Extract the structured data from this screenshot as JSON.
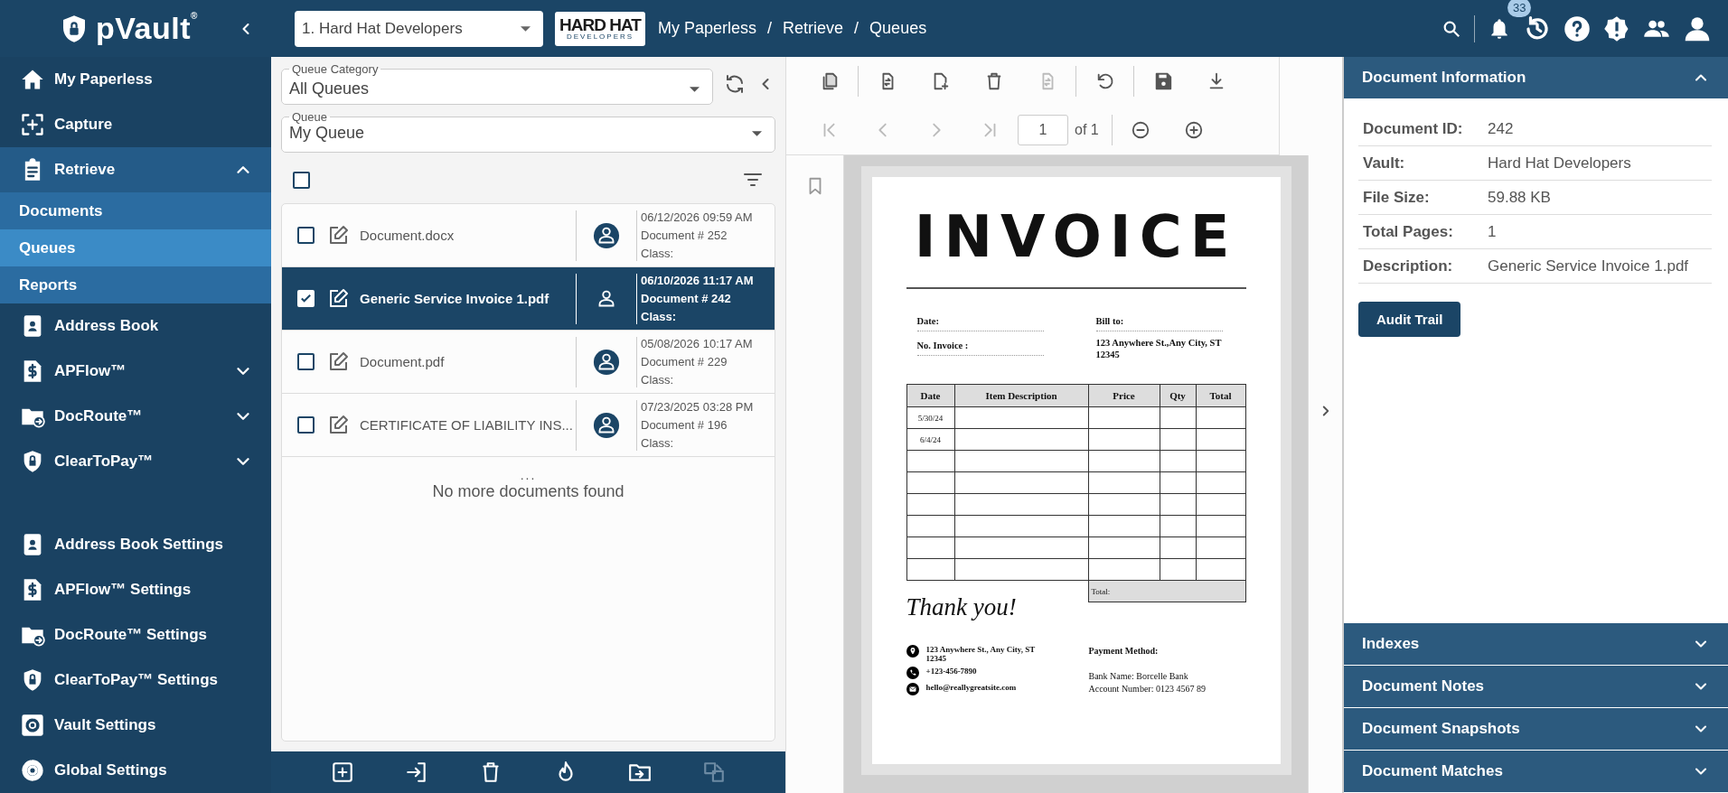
{
  "header": {
    "brand": "pVault$^{®}$",
    "vault_select": "1. Hard Hat Developers",
    "logo_text": "HARD HAT",
    "logo_subtext": "DEVELOPERS",
    "breadcrumbs": [
      "My Paperless",
      "/",
      "Retrieve",
      "/",
      "Queues"
    ],
    "notification_count": "33"
  },
  "sidebar": {
    "items": [
      {
        "label": "My Paperless",
        "kind": "link",
        "selected": false
      },
      {
        "label": "Capture",
        "kind": "link",
        "selected": false
      },
      {
        "label": "Retrieve",
        "kind": "group",
        "selected": false,
        "expanded": true,
        "children": [
          {
            "label": "Documents",
            "selected": false
          },
          {
            "label": "Queues",
            "selected": true
          },
          {
            "label": "Reports",
            "selected": false
          }
        ]
      },
      {
        "label": "Address Book",
        "kind": "link",
        "selected": false
      },
      {
        "label": "APFlow™",
        "kind": "group",
        "selected": false,
        "expanded": false
      },
      {
        "label": "DocRoute™",
        "kind": "group",
        "selected": false,
        "expanded": false
      },
      {
        "label": "ClearToPay™",
        "kind": "group",
        "selected": false,
        "expanded": false
      }
    ],
    "settings_items": [
      {
        "label": "Address Book Settings",
        "selected": false
      },
      {
        "label": "APFlow™ Settings",
        "selected": false
      },
      {
        "label": "DocRoute™ Settings",
        "selected": false
      },
      {
        "label": "ClearToPay™ Settings",
        "selected": false
      },
      {
        "label": "Vault Settings",
        "selected": false
      },
      {
        "label": "Global Settings",
        "selected": false
      }
    ]
  },
  "queue_panel": {
    "category_field": {
      "label": "Queue Category",
      "value": "All Queues"
    },
    "queue_field": {
      "label": "Queue",
      "value": "My Queue"
    },
    "select_all_checked": false,
    "documents": [
      {
        "name": "Document.docx",
        "date": "06/12/2026 09:59 AM",
        "number": "Document # 252",
        "class": "Class:",
        "checked": false,
        "selected": false
      },
      {
        "name": "Generic Service Invoice 1.pdf",
        "date": "06/10/2026 11:17 AM",
        "number": "Document # 242",
        "class": "Class:",
        "checked": true,
        "selected": true
      },
      {
        "name": "Document.pdf",
        "date": "05/08/2026 10:17 AM",
        "number": "Document # 229",
        "class": "Class:",
        "checked": false,
        "selected": false
      },
      {
        "name": "CERTIFICATE OF LIABILITY INS...",
        "date": "07/23/2025 03:28 PM",
        "number": "Document # 196",
        "class": "Class:",
        "checked": false,
        "selected": false
      }
    ],
    "list_end_dots": "...",
    "list_end_text": "No more documents found",
    "toolbar": [
      {
        "kind": "add",
        "disabled": false
      },
      {
        "kind": "move_in",
        "disabled": false
      },
      {
        "kind": "delete",
        "disabled": false
      },
      {
        "kind": "burn",
        "disabled": false
      },
      {
        "kind": "folder_move",
        "disabled": false
      },
      {
        "kind": "split",
        "disabled": true
      }
    ]
  },
  "viewer": {
    "toolbar": [
      {
        "kind": "copy",
        "disabled": false
      },
      {
        "kind": "divider"
      },
      {
        "kind": "swap",
        "disabled": false
      },
      {
        "kind": "add_page",
        "disabled": false
      },
      {
        "kind": "delete",
        "disabled": false
      },
      {
        "kind": "replace",
        "disabled": true
      },
      {
        "kind": "divider"
      },
      {
        "kind": "undo",
        "disabled": false
      },
      {
        "kind": "divider"
      },
      {
        "kind": "save",
        "disabled": false
      },
      {
        "kind": "download",
        "disabled": false
      }
    ],
    "navigation": [
      {
        "kind": "first",
        "disabled": true
      },
      {
        "kind": "prev",
        "disabled": true
      },
      {
        "kind": "next",
        "disabled": true
      },
      {
        "kind": "last",
        "disabled": true
      }
    ],
    "page_field": "1",
    "page_total": "of 1",
    "zoom": [
      {
        "kind": "zoom_out",
        "disabled": false
      },
      {
        "kind": "zoom_in",
        "disabled": false
      }
    ],
    "invoice": {
      "title": "INVOICE",
      "date_label": "Date:",
      "number_label": "No. Invoice :",
      "bill_to_label": "Bill to:",
      "bill_to_address": "123 Anywhere St.,Any City, ST 12345",
      "columns": [
        "Date",
        "Item Description",
        "Price",
        "Qty",
        "Total"
      ],
      "rows": [
        {
          "date": "5/30/24"
        },
        {
          "date": "6/4/24"
        },
        {},
        {},
        {},
        {},
        {},
        {}
      ],
      "total_label": "Total:",
      "thanks": "Thank you!",
      "address": "123 Anywhere St., Any City, ST 12345",
      "phone": "+123-456-7890",
      "email": "hello@reallygreatsite.com",
      "payment_heading": "Payment Method:",
      "bank_name": "Bank Name: Borcelle Bank",
      "account_number": "Account Number: 0123 4567 89"
    }
  },
  "info_panel": {
    "title": "Document Information",
    "expanded": true,
    "fields": [
      {
        "label": "Document ID:",
        "value": "242"
      },
      {
        "label": "Vault:",
        "value": "Hard Hat Developers"
      },
      {
        "label": "File Size:",
        "value": "59.88 KB"
      },
      {
        "label": "Total Pages:",
        "value": "1"
      },
      {
        "label": "Description:",
        "value": "Generic Service Invoice 1.pdf"
      }
    ],
    "button": "Audit Trail",
    "sections": [
      {
        "title": "Indexes",
        "expanded": false
      },
      {
        "title": "Document Notes",
        "expanded": false
      },
      {
        "title": "Document Snapshots",
        "expanded": false
      },
      {
        "title": "Document Matches",
        "expanded": false
      }
    ]
  }
}
